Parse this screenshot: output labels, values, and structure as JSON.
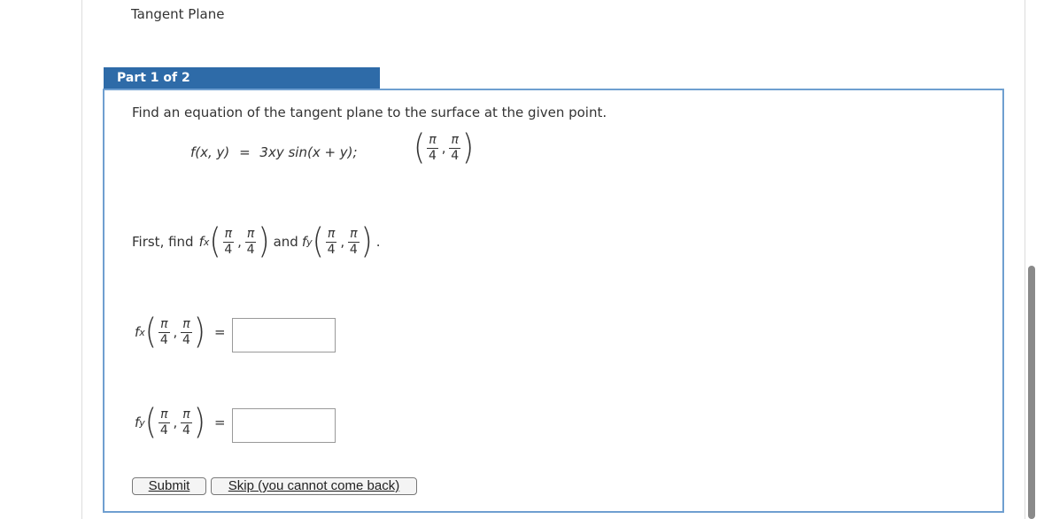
{
  "section": {
    "title": "Tangent Plane"
  },
  "part": {
    "label": "Part 1 of 2"
  },
  "prompt": "Find an equation of the tangent plane to the surface at the given point.",
  "function": {
    "lhs": "f(x, y)",
    "equals": "=",
    "rhs": "3xy sin(x + y);"
  },
  "point": {
    "num1": "π",
    "den1": "4",
    "num2": "π",
    "den2": "4",
    "comma": ","
  },
  "first_find": {
    "lead": "First, find",
    "conj": "and",
    "end": "."
  },
  "fx": {
    "f": "f",
    "sub": "x",
    "equals": "=",
    "value": ""
  },
  "fy": {
    "f": "f",
    "sub": "y",
    "equals": "=",
    "value": ""
  },
  "buttons": {
    "submit": "Submit",
    "skip": "Skip (you cannot come back)"
  }
}
